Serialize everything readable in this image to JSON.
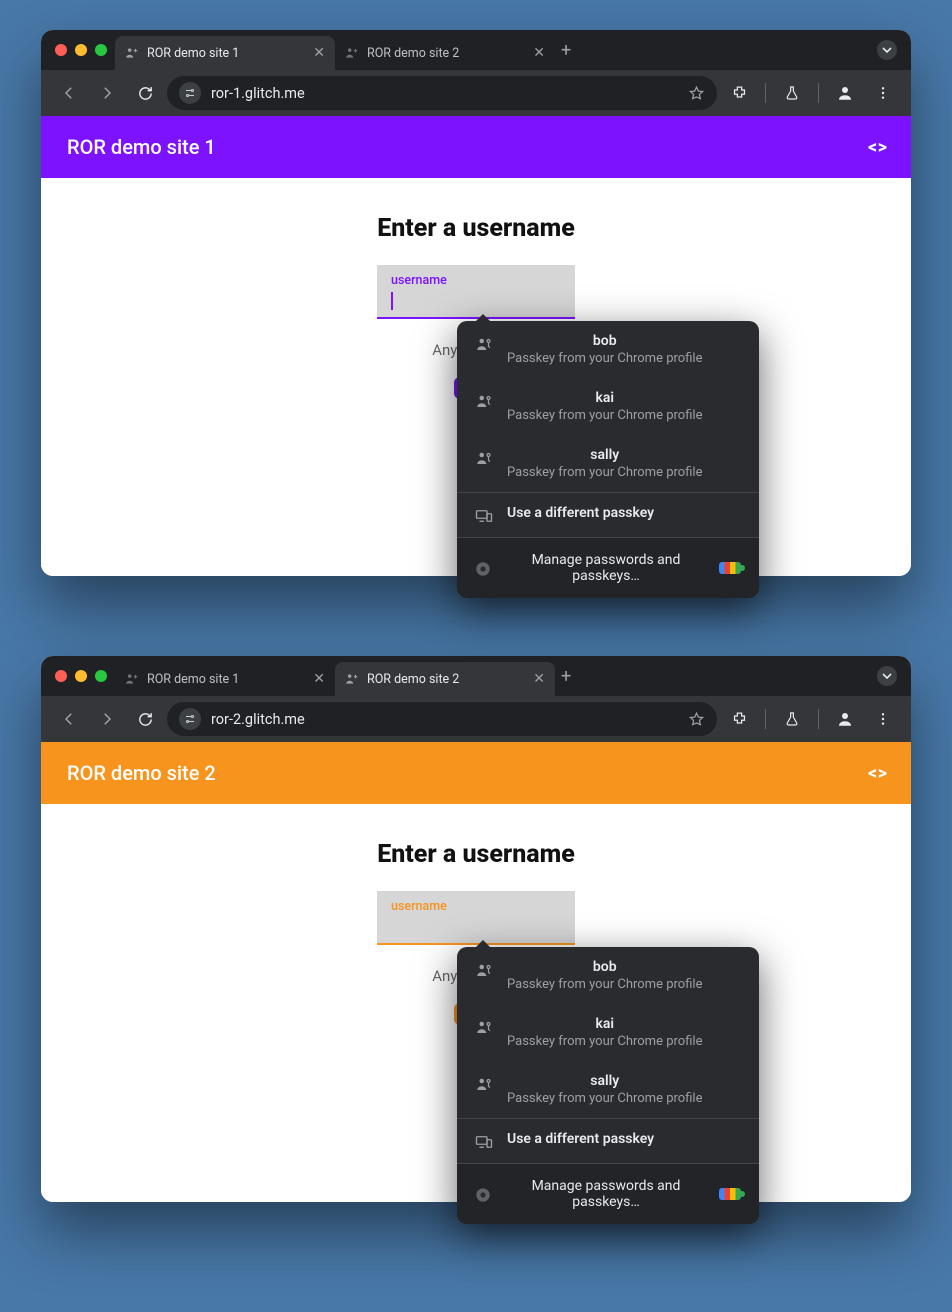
{
  "windows": [
    {
      "id": "w1",
      "active_tab_index": 0,
      "tabs": [
        {
          "title": "ROR demo site 1"
        },
        {
          "title": "ROR demo site 2"
        }
      ],
      "url": "ror-1.glitch.me",
      "appbar_title": "ROR demo site 1",
      "accent": "purple",
      "heading": "Enter a username",
      "field_label": "username",
      "field_value": "",
      "hint_text": "Any usernam",
      "button_label": "",
      "show_caret": true
    },
    {
      "id": "w2",
      "active_tab_index": 1,
      "tabs": [
        {
          "title": "ROR demo site 1"
        },
        {
          "title": "ROR demo site 2"
        }
      ],
      "url": "ror-2.glitch.me",
      "appbar_title": "ROR demo site 2",
      "accent": "orange",
      "heading": "Enter a username",
      "field_label": "username",
      "field_value": "",
      "hint_text": "Any usernam",
      "button_label": "",
      "show_caret": false
    }
  ],
  "passkey_popup": {
    "items": [
      {
        "name": "bob",
        "sub": "Passkey from your Chrome profile"
      },
      {
        "name": "kai",
        "sub": "Passkey from your Chrome profile"
      },
      {
        "name": "sally",
        "sub": "Passkey from your Chrome profile"
      }
    ],
    "different": "Use a different passkey",
    "manage": "Manage passwords and passkeys…"
  }
}
